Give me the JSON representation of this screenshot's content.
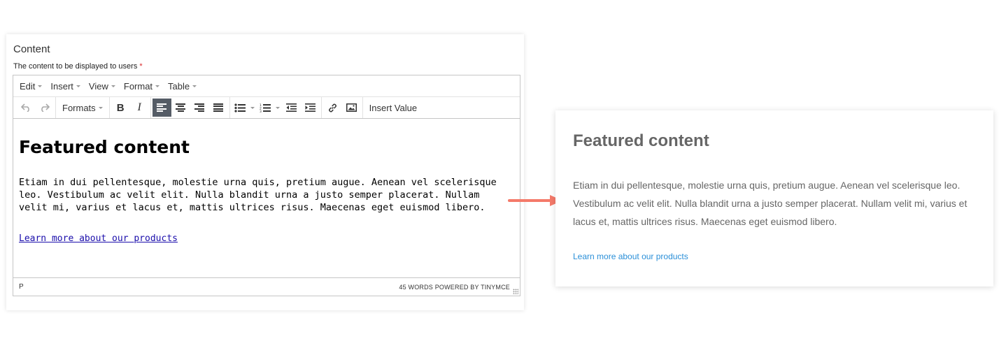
{
  "field": {
    "title": "Content",
    "description": "The content to be displayed to users",
    "required_mark": "*"
  },
  "menubar": [
    "Edit",
    "Insert",
    "View",
    "Format",
    "Table"
  ],
  "toolbar": {
    "formats_label": "Formats",
    "bold_label": "B",
    "italic_label": "I",
    "insert_value_label": "Insert Value",
    "active_alignment": "align-left"
  },
  "editor_content": {
    "heading": "Featured content",
    "paragraph": "Etiam in dui pellentesque, molestie urna quis, pretium augue. Aenean vel scelerisque leo. Vestibulum ac velit elit. Nulla blandit urna a justo semper placerat. Nullam velit mi, varius et lacus et, mattis ultrices risus. Maecenas eget euismod libero.",
    "link": "Learn more about our products"
  },
  "statusbar": {
    "path": "P",
    "word_count": "45 WORDS",
    "powered_by": "POWERED BY TINYMCE"
  },
  "preview": {
    "heading": "Featured content",
    "paragraph": "Etiam in dui pellentesque, molestie urna quis, pretium augue. Aenean vel scelerisque leo. Vestibulum ac velit elit. Nulla blandit urna a justo semper placerat. Nullam velit mi, varius et lacus et, mattis ultrices risus. Maecenas eget euismod libero.",
    "link": "Learn more about our products"
  },
  "colors": {
    "arrow": "#f47a6a",
    "preview_link": "#2a8fd8",
    "active_button": "#555c66",
    "required": "#d9292b"
  }
}
